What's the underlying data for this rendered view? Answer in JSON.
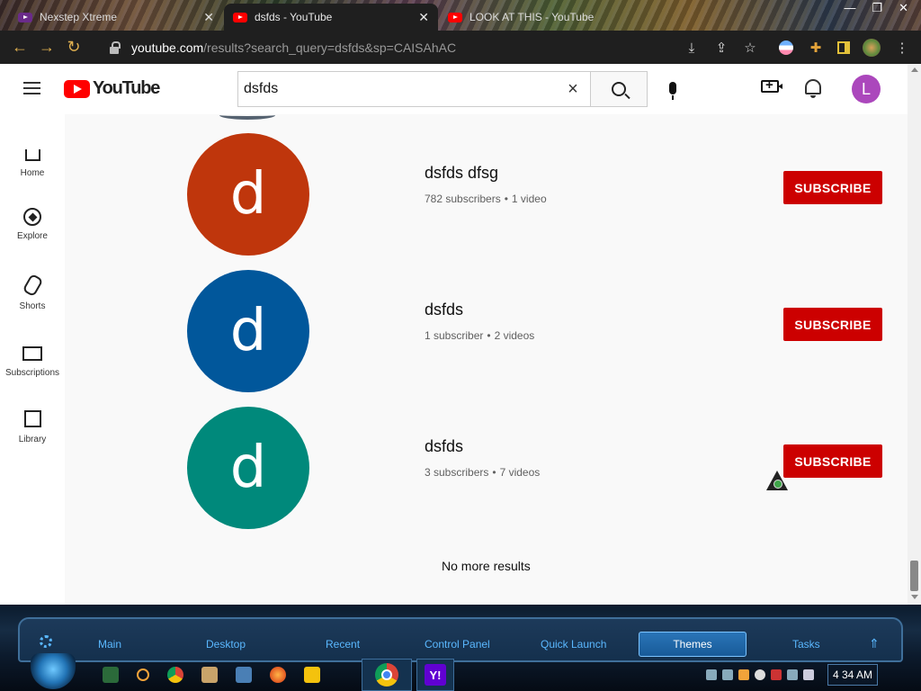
{
  "browser": {
    "tabs": [
      {
        "title": "Nexstep Xtreme",
        "active": false
      },
      {
        "title": "dsfds - YouTube",
        "active": true
      },
      {
        "title": "LOOK AT THIS - YouTube",
        "active": false
      }
    ],
    "url_domain": "youtube.com",
    "url_path": "/results?search_query=dsfds&sp=CAISAhAC",
    "toolbar_icons": [
      "install-icon",
      "share-icon",
      "star-icon",
      "profile-flag-icon",
      "extensions-icon",
      "sidebar-icon",
      "account-icon",
      "menu-icon"
    ]
  },
  "youtube": {
    "logo_text": "YouTube",
    "search": {
      "value": "dsfds",
      "placeholder": "Search"
    },
    "avatar_letter": "L",
    "avatar_color": "#ab47bc",
    "sidebar": [
      {
        "label": "Home",
        "icon": "home-icon"
      },
      {
        "label": "Explore",
        "icon": "compass-icon"
      },
      {
        "label": "Shorts",
        "icon": "shorts-icon"
      },
      {
        "label": "Subscriptions",
        "icon": "subscriptions-icon"
      },
      {
        "label": "Library",
        "icon": "library-icon"
      }
    ],
    "channels": [
      {
        "letter": "d",
        "color": "#bf360c",
        "name": "dsfds dfsg",
        "subscribers": "782 subscribers",
        "videos": "1 video",
        "button": "SUBSCRIBE"
      },
      {
        "letter": "d",
        "color": "#01579b",
        "name": "dsfds",
        "subscribers": "1 subscriber",
        "videos": "2 videos",
        "button": "SUBSCRIBE"
      },
      {
        "letter": "d",
        "color": "#00897b",
        "name": "dsfds",
        "subscribers": "3 subscribers",
        "videos": "7 videos",
        "button": "SUBSCRIBE"
      }
    ],
    "end_text": "No more results",
    "separator": "•"
  },
  "taskbar": {
    "menu": [
      "Main",
      "Desktop",
      "Recent",
      "Control Panel",
      "Quick Launch",
      "Themes",
      "Tasks"
    ],
    "active_menu": "Themes",
    "clock": "4 34 AM",
    "accent": "#5ab8ff"
  }
}
